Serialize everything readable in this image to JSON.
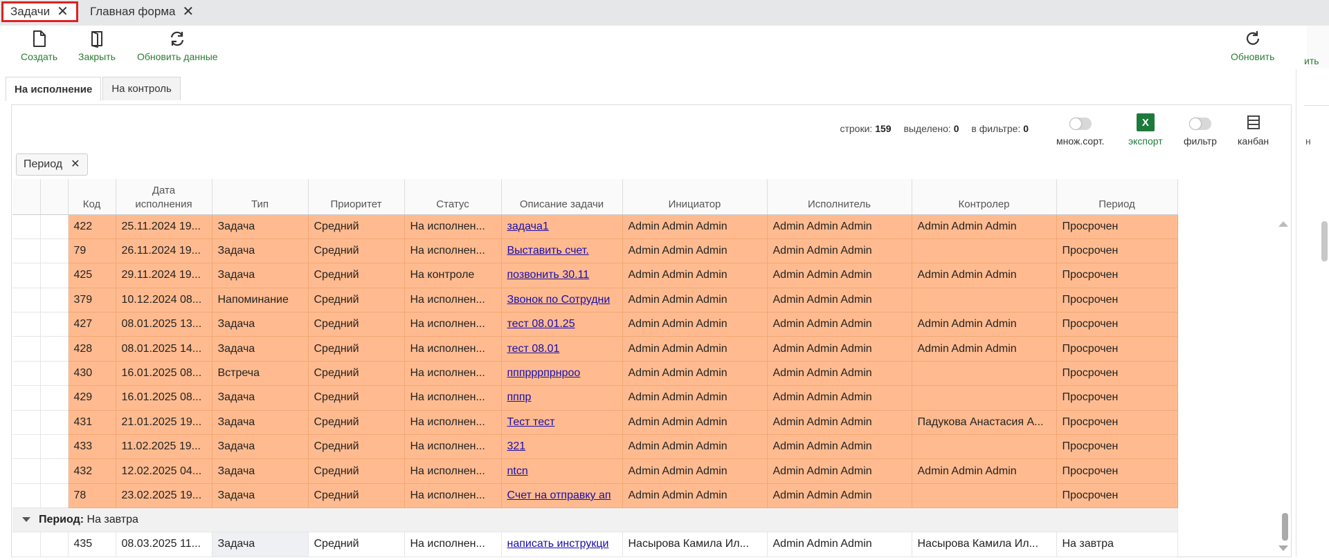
{
  "tabs": [
    {
      "label": "Задачи",
      "active": true
    },
    {
      "label": "Главная форма",
      "active": false
    }
  ],
  "toolbar": {
    "create": "Создать",
    "close": "Закрыть",
    "refresh_data": "Обновить данные",
    "refresh": "Обновить",
    "edge_text": "ить"
  },
  "subtabs": [
    {
      "label": "На исполнение",
      "active": true
    },
    {
      "label": "На контроль",
      "active": false
    }
  ],
  "stats": {
    "rows_label": "строки:",
    "rows": "159",
    "selected_label": "выделено:",
    "selected": "0",
    "filtered_label": "в фильтре:",
    "filtered": "0"
  },
  "tools": {
    "multisort": "множ.сорт.",
    "export": "экспорт",
    "excel_glyph": "X",
    "filter": "фильтр",
    "kanban": "канбан"
  },
  "filter_chip": "Период",
  "columns": {
    "code": "Код",
    "due_date_line1": "Дата",
    "due_date_line2": "исполнения",
    "type": "Тип",
    "priority": "Приоритет",
    "status": "Статус",
    "description": "Описание задачи",
    "initiator": "Инициатор",
    "executor": "Исполнитель",
    "controller": "Контролер",
    "period": "Период"
  },
  "rows_overdue": [
    {
      "code": "422",
      "date": "25.11.2024 19...",
      "type": "Задача",
      "priority": "Средний",
      "status": "На исполнен...",
      "desc": "задача1",
      "initiator": "Admin Admin Admin",
      "executor": "Admin Admin Admin",
      "controller": "Admin Admin Admin",
      "period": "Просрочен"
    },
    {
      "code": "79",
      "date": "26.11.2024 19...",
      "type": "Задача",
      "priority": "Средний",
      "status": "На исполнен...",
      "desc": "Выставить счет.",
      "initiator": "Admin Admin Admin",
      "executor": "Admin Admin Admin",
      "controller": "",
      "period": "Просрочен"
    },
    {
      "code": "425",
      "date": "29.11.2024 19...",
      "type": "Задача",
      "priority": "Средний",
      "status": "На контроле",
      "desc": "позвонить 30.11",
      "initiator": "Admin Admin Admin",
      "executor": "Admin Admin Admin",
      "controller": "Admin Admin Admin",
      "period": "Просрочен"
    },
    {
      "code": "379",
      "date": "10.12.2024 08...",
      "type": "Напоминание",
      "priority": "Средний",
      "status": "На исполнен...",
      "desc": "Звонок по Сотрудни",
      "initiator": "Admin Admin Admin",
      "executor": "Admin Admin Admin",
      "controller": "",
      "period": "Просрочен"
    },
    {
      "code": "427",
      "date": "08.01.2025 13...",
      "type": "Задача",
      "priority": "Средний",
      "status": "На исполнен...",
      "desc": "тест 08.01.25",
      "initiator": "Admin Admin Admin",
      "executor": "Admin Admin Admin",
      "controller": "Admin Admin Admin",
      "period": "Просрочен"
    },
    {
      "code": "428",
      "date": "08.01.2025 14...",
      "type": "Задача",
      "priority": "Средний",
      "status": "На исполнен...",
      "desc": "тест 08.01",
      "initiator": "Admin Admin Admin",
      "executor": "Admin Admin Admin",
      "controller": "Admin Admin Admin",
      "period": "Просрочен"
    },
    {
      "code": "430",
      "date": "16.01.2025 08...",
      "type": "Встреча",
      "priority": "Средний",
      "status": "На исполнен...",
      "desc": "пппрррпрнроо",
      "initiator": "Admin Admin Admin",
      "executor": "Admin Admin Admin",
      "controller": "",
      "period": "Просрочен"
    },
    {
      "code": "429",
      "date": "16.01.2025 08...",
      "type": "Задача",
      "priority": "Средний",
      "status": "На исполнен...",
      "desc": "пппр",
      "initiator": "Admin Admin Admin",
      "executor": "Admin Admin Admin",
      "controller": "",
      "period": "Просрочен"
    },
    {
      "code": "431",
      "date": "21.01.2025 19...",
      "type": "Задача",
      "priority": "Средний",
      "status": "На исполнен...",
      "desc": "Тест тест",
      "initiator": "Admin Admin Admin",
      "executor": "Admin Admin Admin",
      "controller": "Падукова Анастасия А...",
      "period": "Просрочен"
    },
    {
      "code": "433",
      "date": "11.02.2025 19...",
      "type": "Задача",
      "priority": "Средний",
      "status": "На исполнен...",
      "desc": "321",
      "initiator": "Admin Admin Admin",
      "executor": "Admin Admin Admin",
      "controller": "",
      "period": "Просрочен"
    },
    {
      "code": "432",
      "date": "12.02.2025 04...",
      "type": "Задача",
      "priority": "Средний",
      "status": "На исполнен...",
      "desc": "ntcn",
      "initiator": "Admin Admin Admin",
      "executor": "Admin Admin Admin",
      "controller": "Admin Admin Admin",
      "period": "Просрочен"
    },
    {
      "code": "78",
      "date": "23.02.2025 19...",
      "type": "Задача",
      "priority": "Средний",
      "status": "На исполнен...",
      "desc": "Счет на отправку ап",
      "initiator": "Admin Admin Admin",
      "executor": "Admin Admin Admin",
      "controller": "",
      "period": "Просрочен"
    }
  ],
  "group": {
    "label": "Период:",
    "value": "На завтра"
  },
  "row_tomorrow": {
    "code": "435",
    "date": "08.03.2025 11...",
    "type": "Задача",
    "priority": "Средний",
    "status": "На исполнен...",
    "desc": "написать инструкци",
    "initiator": "Насырова Камила Ил...",
    "executor": "Admin Admin Admin",
    "controller": "Насырова Камила Ил...",
    "period": "На завтра"
  },
  "colors": {
    "overdue_row": "#ffbb8f",
    "accent_green": "#2a7b33",
    "link": "#1a0dab",
    "active_tab_border": "#e02020"
  },
  "icons": [
    "close-icon",
    "file-icon",
    "door-icon",
    "sync-icon",
    "refresh-icon",
    "excel-icon",
    "kanban-icon",
    "caret-down-icon"
  ]
}
